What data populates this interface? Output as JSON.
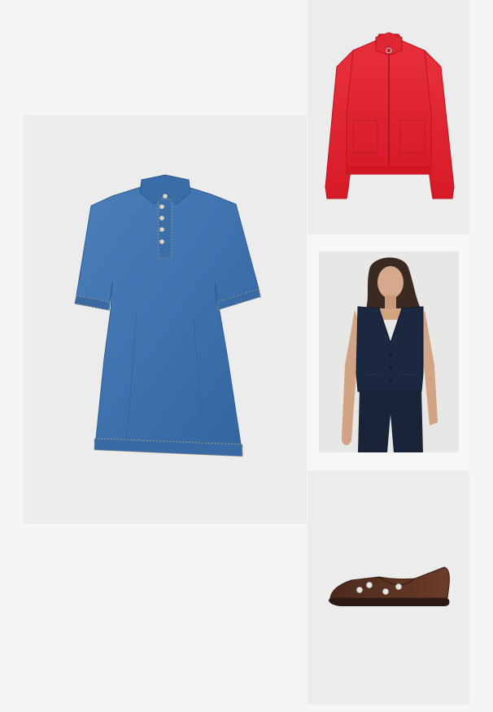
{
  "products": [
    {
      "id": "denim-dress",
      "icon": "denim-shirt-dress-image",
      "color": "#3f72ae"
    },
    {
      "id": "red-cardigan",
      "icon": "red-zip-cardigan-image",
      "color": "#e0202e"
    },
    {
      "id": "navy-waistcoat",
      "icon": "model-navy-waistcoat-image",
      "color": "#1c2740"
    },
    {
      "id": "brown-flats",
      "icon": "brown-suede-flat-shoe-image",
      "color": "#5a3222"
    }
  ],
  "background": "#f5f5f5",
  "tile_color": "#ececec"
}
